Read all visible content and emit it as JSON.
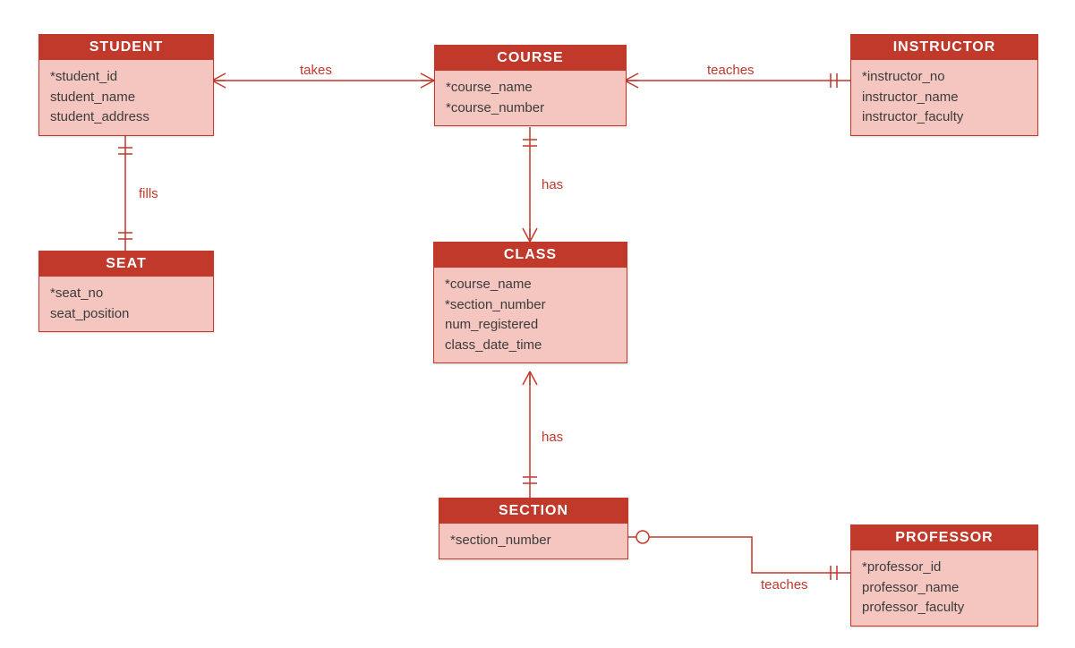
{
  "colors": {
    "accent": "#c0392b",
    "body": "#f5c6bf"
  },
  "entities": {
    "student": {
      "title": "STUDENT",
      "attrs": [
        "*student_id",
        "student_name",
        "student_address"
      ]
    },
    "course": {
      "title": "COURSE",
      "attrs": [
        "*course_name",
        "*course_number"
      ]
    },
    "instructor": {
      "title": "INSTRUCTOR",
      "attrs": [
        "*instructor_no",
        "instructor_name",
        "instructor_faculty"
      ]
    },
    "seat": {
      "title": "SEAT",
      "attrs": [
        "*seat_no",
        "seat_position"
      ]
    },
    "class": {
      "title": "CLASS",
      "attrs": [
        "*course_name",
        "*section_number",
        "num_registered",
        "class_date_time"
      ]
    },
    "section": {
      "title": "SECTION",
      "attrs": [
        "*section_number"
      ]
    },
    "professor": {
      "title": "PROFESSOR",
      "attrs": [
        "*professor_id",
        "professor_name",
        "professor_faculty"
      ]
    }
  },
  "relationships": {
    "student_course": {
      "label": "takes"
    },
    "course_instructor": {
      "label": "teaches"
    },
    "student_seat": {
      "label": "fills"
    },
    "course_class": {
      "label": "has"
    },
    "class_section": {
      "label": "has"
    },
    "section_professor": {
      "label": "teaches"
    }
  }
}
